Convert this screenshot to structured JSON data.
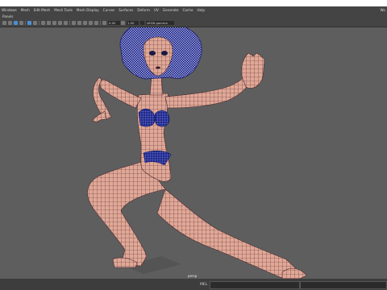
{
  "menubar": {
    "items": [
      "Windows",
      "Mesh",
      "Edit Mesh",
      "Mesh Tools",
      "Mesh Display",
      "Curves",
      "Surfaces",
      "Deform",
      "UV",
      "Generate",
      "Cache",
      "Help"
    ],
    "right": "Wo"
  },
  "panel": {
    "label": "Panels"
  },
  "toolbar": {
    "field_a": "0.00",
    "field_b": "1.00",
    "colorspace": "sRGB gamma"
  },
  "viewport": {
    "camera": "persp"
  },
  "status": {
    "mel": "MEL"
  }
}
